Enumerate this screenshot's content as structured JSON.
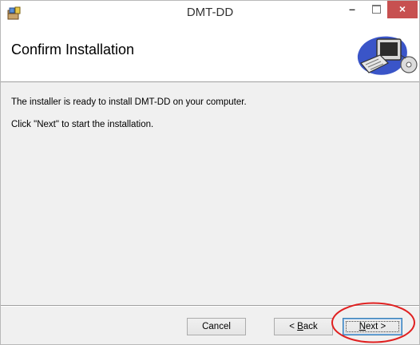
{
  "window": {
    "title": "DMT-DD",
    "minimize_glyph": "–",
    "close_glyph": "×"
  },
  "header": {
    "title": "Confirm Installation"
  },
  "body": {
    "line1": "The installer is ready to install DMT-DD on your computer.",
    "line2": "Click \"Next\" to start the installation."
  },
  "buttons": {
    "cancel": "Cancel",
    "back_prefix": "< ",
    "back_mnemonic": "B",
    "back_rest": "ack",
    "next_mnemonic": "N",
    "next_rest": "ext >"
  },
  "icons": {
    "app": "installer-box-icon",
    "header": "computer-with-cd-icon"
  },
  "colors": {
    "close_button": "#c75050",
    "highlight_oval": "#e02020",
    "default_button_border": "#3c7fb1"
  }
}
